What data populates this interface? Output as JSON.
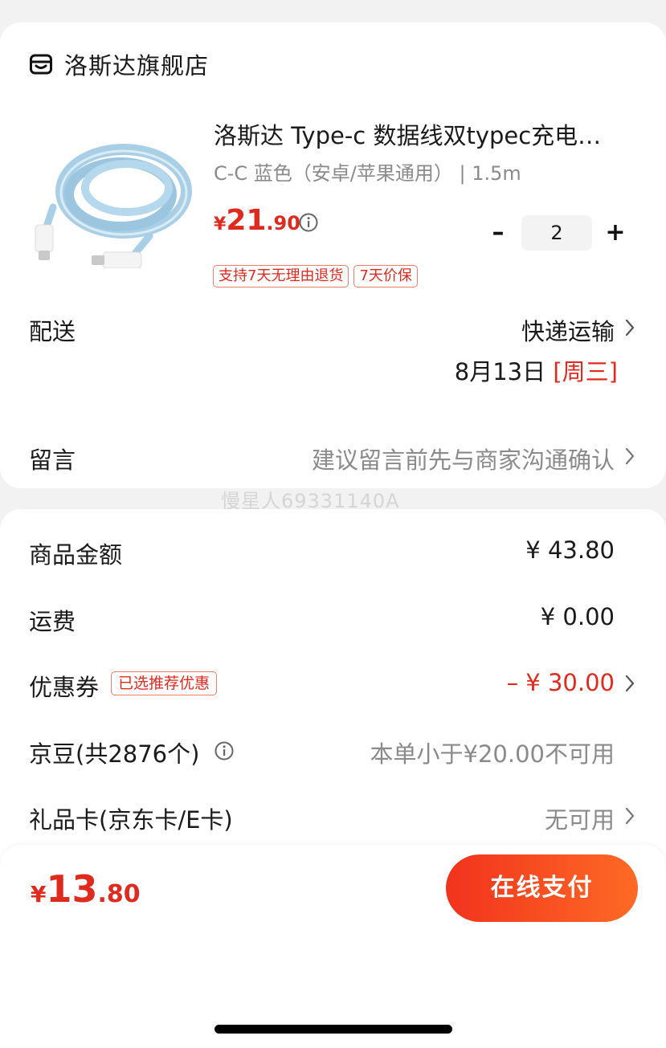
{
  "store": {
    "name": "洛斯达旗舰店",
    "icon": "store-icon"
  },
  "product": {
    "title": "洛斯达 Type-c 数据线双typec充电…",
    "spec": "C-C 蓝色（安卓/苹果通用） | 1.5m",
    "price_symbol": "¥",
    "price_int": "21",
    "price_dec": ".90",
    "quantity": "2",
    "minus_label": "–",
    "plus_label": "+",
    "tags": [
      "支持7天无理由退货",
      "7天价保"
    ]
  },
  "delivery": {
    "label": "配送",
    "method": "快递运输",
    "date": "8月13日",
    "weekday": "[周三]"
  },
  "message": {
    "label": "留言",
    "placeholder": "建议留言前先与商家沟通确认"
  },
  "watermark": "慢星人69331140A",
  "fees": {
    "goods_label": "商品金额",
    "goods_value": "¥ 43.80",
    "shipping_label": "运费",
    "shipping_value": "¥ 0.00",
    "coupon_label": "优惠券",
    "coupon_tag": "已选推荐优惠",
    "coupon_value": "– ¥ 30.00",
    "beans_label": "京豆(共2876个)",
    "beans_value": "本单小于¥20.00不可用",
    "giftcard_label": "礼品卡(京东卡/E卡)",
    "giftcard_value": "无可用"
  },
  "footer": {
    "total_symbol": "¥",
    "total_int": "13",
    "total_dec": ".80",
    "pay_label": "在线支付"
  },
  "colors": {
    "accent": "#e02a1e",
    "button_start": "#f1331d",
    "button_end": "#fe6a25"
  }
}
